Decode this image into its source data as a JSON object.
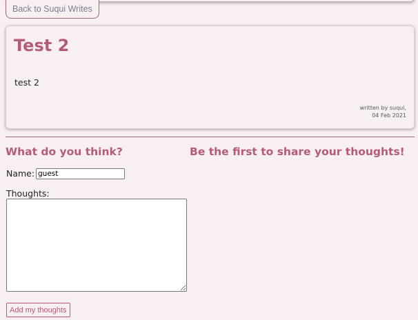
{
  "nav": {
    "back_label": "Back to Suqui Writes"
  },
  "post": {
    "title": "Test 2",
    "body": "test 2",
    "author_line": "written by suqui,",
    "date": "04 Feb 2021"
  },
  "comment_form": {
    "heading": "What do you think?",
    "name_label": "Name:",
    "name_value": "guest",
    "thoughts_label": "Thoughts:",
    "thoughts_value": "",
    "submit_label": "Add my thoughts"
  },
  "comments": {
    "empty_heading": "Be the first to share your thoughts!"
  },
  "colors": {
    "accent": "#b35b78",
    "background": "#f8f0f0",
    "divider": "#a56b78"
  }
}
